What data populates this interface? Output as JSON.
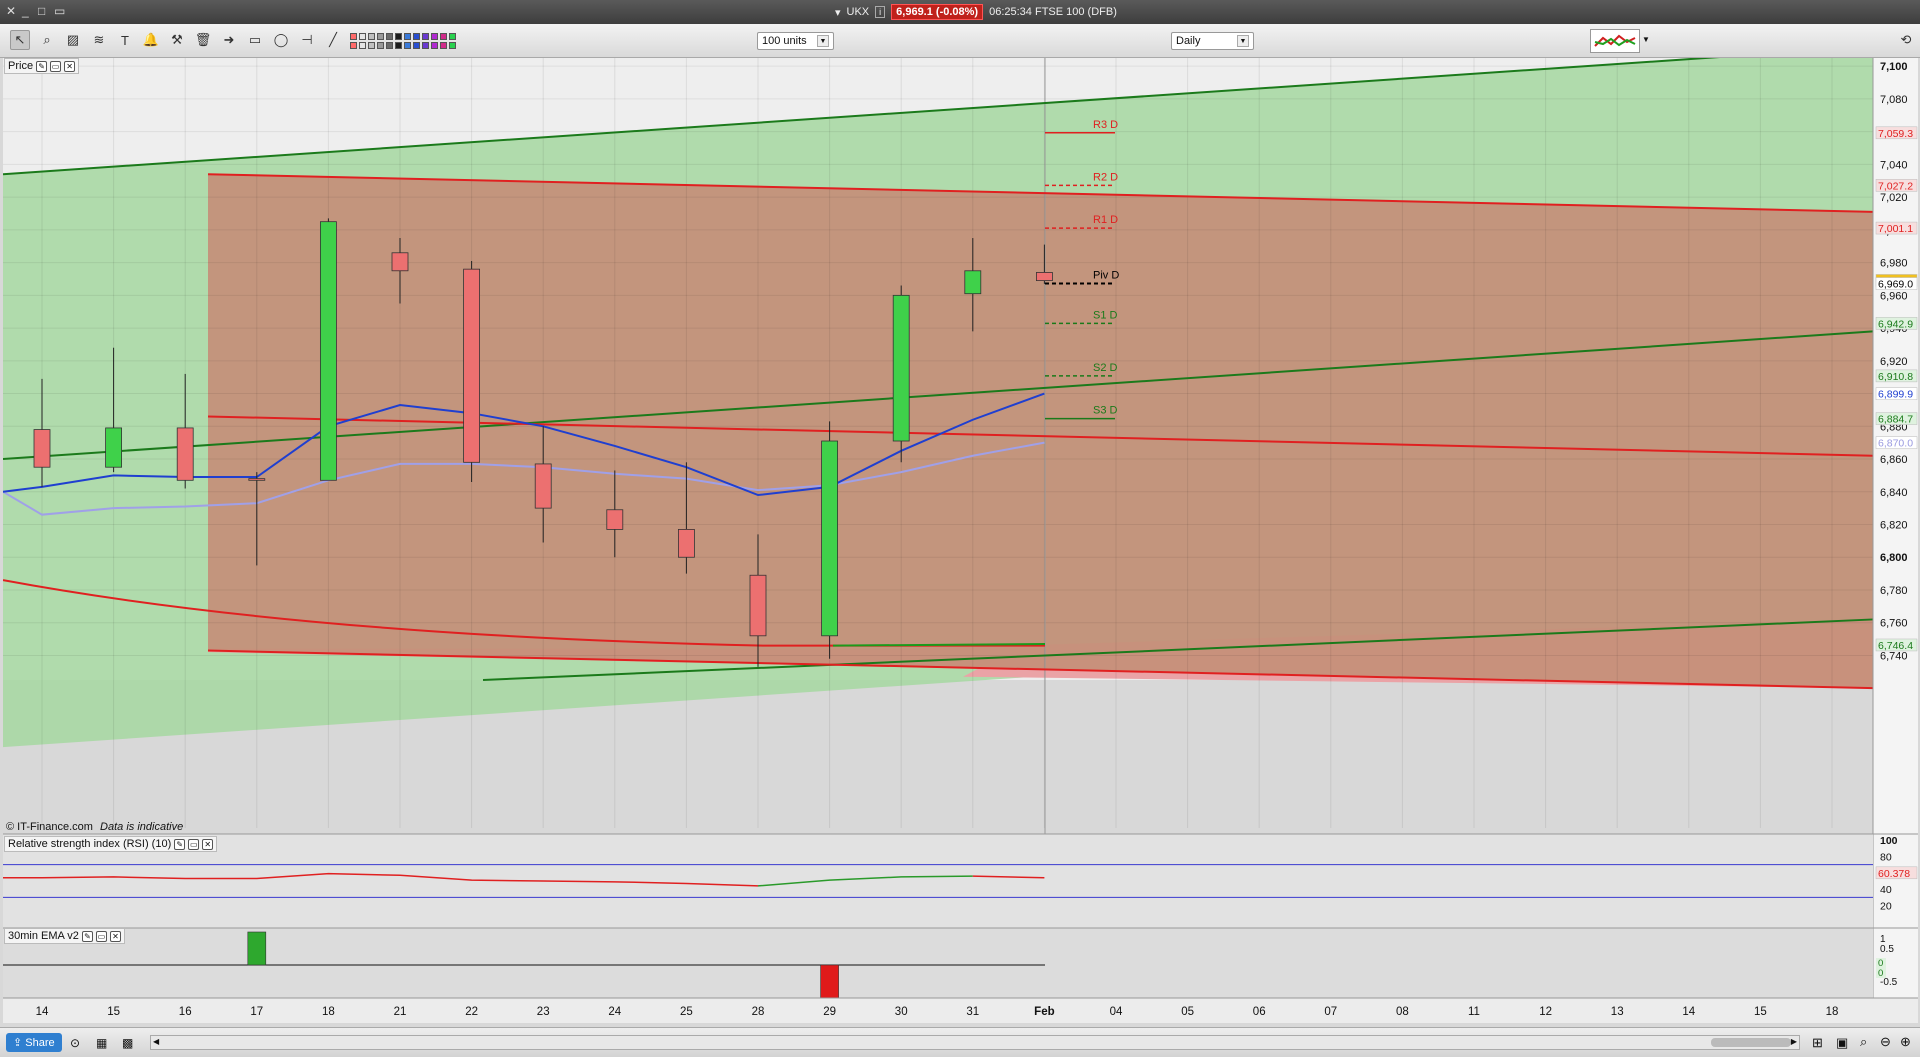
{
  "titlebar": {
    "window_controls": [
      "✕",
      "_",
      "□",
      "▭"
    ],
    "symbol": "UKX",
    "price_change": "6,969.1 (-0.08%)",
    "time_market": "06:25:34 FTSE 100 (DFB)"
  },
  "toolbar": {
    "units_select": "100 units",
    "timeframe_select": "Daily",
    "swatch_colors": [
      "#ff6b6b",
      "#e5e5e5",
      "#c0c0c0",
      "#9a9a9a",
      "#6b6b6b",
      "#1c1c1c",
      "#3a7ad9",
      "#2a4fd1",
      "#6a3ad1",
      "#b12ad1",
      "#d12a8a",
      "#2ad14f"
    ],
    "tool_icons": [
      "pointer-icon",
      "zoom-icon",
      "chart-style-icon",
      "text-tool-icon",
      "fibonacci-icon",
      "alert-icon",
      "drawing-settings-icon",
      "trash-icon",
      "rectangle-icon",
      "ellipse-icon",
      "horizontal-line-icon",
      "trend-line-icon"
    ]
  },
  "panels": {
    "price_label": "Price",
    "rsi_label": "Relative strength index (RSI) (10)",
    "ema_label": "30min EMA v2",
    "watermark": "© IT-Finance.com",
    "disclaimer": "Data is indicative"
  },
  "price_axis": {
    "ticks": [
      "7,100",
      "7,080",
      "7,060",
      "7,040",
      "7,020",
      "7,000",
      "6,980",
      "6,960",
      "6,940",
      "6,920",
      "6,900",
      "6,880",
      "6,860",
      "6,840",
      "6,820",
      "6,800",
      "6,780",
      "6,760",
      "6,740"
    ],
    "markers": [
      {
        "label": "7,059.3",
        "value": 7059.3,
        "color": "#e02020",
        "bg": "#f7dede"
      },
      {
        "label": "7,027.2",
        "value": 7027.2,
        "color": "#e02020",
        "bg": "#f7dede"
      },
      {
        "label": "7,001.1",
        "value": 7001.1,
        "color": "#e02020",
        "bg": "#f7dede"
      },
      {
        "label": "6,969.1",
        "value": 6969.1,
        "color": "#000000",
        "bg": "#f0c020"
      },
      {
        "label": "6,969.0",
        "value": 6967.2,
        "color": "#000000",
        "bg": "#ffffff"
      },
      {
        "label": "6,942.9",
        "value": 6942.9,
        "color": "#1a7a1a",
        "bg": "#dff2df"
      },
      {
        "label": "6,910.8",
        "value": 6910.8,
        "color": "#1a7a1a",
        "bg": "#dff2df"
      },
      {
        "label": "6,899.9",
        "value": 6899.9,
        "color": "#1f3fd0",
        "bg": "#ffffff"
      },
      {
        "label": "6,884.7",
        "value": 6884.7,
        "color": "#1a7a1a",
        "bg": "#dff2df"
      },
      {
        "label": "6,870.0",
        "value": 6870.0,
        "color": "#9a9ae0",
        "bg": "#ffffff"
      },
      {
        "label": "6,746.4",
        "value": 6746.4,
        "color": "#1a7a1a",
        "bg": "#dff2df"
      }
    ]
  },
  "pivots": [
    {
      "label": "R3 D",
      "value": 7059.3,
      "color": "#e02020",
      "dashed": false
    },
    {
      "label": "R2 D",
      "value": 7027.2,
      "color": "#e02020",
      "dashed": true
    },
    {
      "label": "R1 D",
      "value": 7001.1,
      "color": "#e02020",
      "dashed": true
    },
    {
      "label": "Piv D",
      "value": 6967.2,
      "color": "#000000",
      "dashed": true
    },
    {
      "label": "S1 D",
      "value": 6942.9,
      "color": "#1a7a1a",
      "dashed": true
    },
    {
      "label": "S2 D",
      "value": 6910.8,
      "color": "#1a7a1a",
      "dashed": true
    },
    {
      "label": "S3 D",
      "value": 6884.7,
      "color": "#1a7a1a",
      "dashed": false
    }
  ],
  "x_axis": [
    "14",
    "15",
    "16",
    "17",
    "18",
    "21",
    "22",
    "23",
    "24",
    "25",
    "28",
    "29",
    "30",
    "31",
    "Feb",
    "04",
    "05",
    "06",
    "07",
    "08",
    "11",
    "12",
    "13",
    "14",
    "15",
    "18"
  ],
  "rsi_axis": [
    "100",
    "80",
    "60",
    "40",
    "20"
  ],
  "rsi_value": "60.378",
  "ema_axis": [
    "1",
    "0.5",
    "0",
    "-0.5"
  ],
  "ema_values": [
    "0",
    "0"
  ],
  "chart_data": {
    "type": "candlestick",
    "ylim": [
      6725,
      7105
    ],
    "candles": [
      {
        "x": "14",
        "open": 6878,
        "high": 6909,
        "low": 6843,
        "close": 6855
      },
      {
        "x": "15",
        "open": 6855,
        "high": 6928,
        "low": 6852,
        "close": 6879
      },
      {
        "x": "16",
        "open": 6879,
        "high": 6912,
        "low": 6842,
        "close": 6847
      },
      {
        "x": "17",
        "open": 6848,
        "high": 6852,
        "low": 6795,
        "close": 6847
      },
      {
        "x": "18",
        "open": 6847,
        "high": 7007,
        "low": 6847,
        "close": 7005
      },
      {
        "x": "21",
        "open": 6986,
        "high": 6995,
        "low": 6955,
        "close": 6975
      },
      {
        "x": "22",
        "open": 6976,
        "high": 6981,
        "low": 6846,
        "close": 6858
      },
      {
        "x": "23",
        "open": 6857,
        "high": 6880,
        "low": 6809,
        "close": 6830
      },
      {
        "x": "24",
        "open": 6829,
        "high": 6853,
        "low": 6800,
        "close": 6817
      },
      {
        "x": "25",
        "open": 6817,
        "high": 6858,
        "low": 6790,
        "close": 6800
      },
      {
        "x": "28",
        "open": 6789,
        "high": 6814,
        "low": 6733,
        "close": 6752
      },
      {
        "x": "29",
        "open": 6752,
        "high": 6883,
        "low": 6738,
        "close": 6871
      },
      {
        "x": "30",
        "open": 6871,
        "high": 6966,
        "low": 6858,
        "close": 6960
      },
      {
        "x": "31",
        "open": 6961,
        "high": 6995,
        "low": 6938,
        "close": 6975
      },
      {
        "x": "Feb",
        "open": 6974,
        "high": 6991,
        "low": 6967,
        "close": 6969
      }
    ],
    "ma_fast": [
      6843,
      6850,
      6849,
      6849,
      6880,
      6893,
      6888,
      6880,
      6868,
      6855,
      6838,
      6843,
      6865,
      6884,
      6900
    ],
    "ma_slow": [
      6826,
      6830,
      6831,
      6833,
      6847,
      6857,
      6857,
      6855,
      6851,
      6848,
      6841,
      6844,
      6852,
      6862,
      6870
    ],
    "rsi": [
      54,
      55,
      53,
      53,
      59,
      57,
      51,
      50,
      49,
      47,
      44,
      51,
      55,
      56,
      54
    ],
    "ema_signal": [
      0,
      0,
      0,
      1,
      0,
      0,
      0,
      0,
      0,
      0,
      0,
      -1,
      0,
      0,
      0
    ]
  },
  "statusbar": {
    "share_label": "Share"
  }
}
